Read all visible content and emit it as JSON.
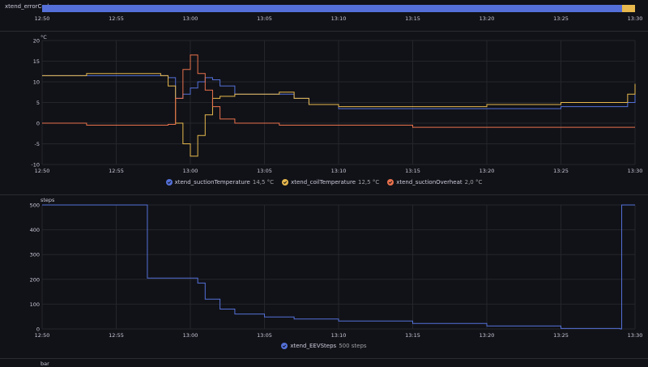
{
  "state_timeline": {
    "label": "xtend_errorCode",
    "x_ticks": [
      "12:50",
      "12:55",
      "13:00",
      "13:05",
      "13:10",
      "13:15",
      "13:20",
      "13:25",
      "13:30"
    ],
    "colors": {
      "main": "#5470d8",
      "end": "#e6b84d"
    }
  },
  "temp_panel": {
    "unit": "°C",
    "y_ticks": [
      "20",
      "15",
      "10",
      "5",
      "0",
      "-5",
      "-10"
    ],
    "x_ticks": [
      "12:50",
      "12:55",
      "13:00",
      "13:05",
      "13:10",
      "13:15",
      "13:20",
      "13:25",
      "13:30"
    ],
    "legend": [
      {
        "name": "xtend_suctionTemperature",
        "value": "14,5 °C",
        "color": "#5470d8"
      },
      {
        "name": "xtend_coilTemperature",
        "value": "12,5 °C",
        "color": "#e6b84d"
      },
      {
        "name": "xtend_suctionOverheat",
        "value": "2,0 °C",
        "color": "#e8714c"
      }
    ]
  },
  "eev_panel": {
    "unit": "steps",
    "y_ticks": [
      "500",
      "400",
      "300",
      "200",
      "100",
      "0"
    ],
    "x_ticks": [
      "12:50",
      "12:55",
      "13:00",
      "13:05",
      "13:10",
      "13:15",
      "13:20",
      "13:25",
      "13:30"
    ],
    "legend": [
      {
        "name": "xtend_EEVSteps",
        "value": "500 steps",
        "color": "#5470d8"
      }
    ]
  },
  "bar_panel": {
    "unit": "bar"
  },
  "chart_data": [
    {
      "type": "line",
      "ylabel": "°C",
      "ylim": [
        -10,
        20
      ],
      "xlim": [
        "12:50",
        "13:30"
      ],
      "grid": true,
      "legend": "bottom",
      "x": [
        "12:50",
        "12:53",
        "12:56",
        "12:58",
        "12:58.5",
        "12:59",
        "12:59.5",
        "13:00",
        "13:00.5",
        "13:01",
        "13:01.5",
        "13:02",
        "13:03",
        "13:05",
        "13:06",
        "13:07",
        "13:08",
        "13:10",
        "13:15",
        "13:20",
        "13:25",
        "13:29",
        "13:29.5",
        "13:30"
      ],
      "series": [
        {
          "name": "xtend_suctionTemperature",
          "color": "#5470d8",
          "values": [
            11.5,
            11.5,
            11.5,
            11.5,
            11,
            6,
            7,
            8.5,
            10,
            11,
            10.5,
            9,
            7,
            7,
            7,
            6,
            4.5,
            3.5,
            3.5,
            3.5,
            4,
            4,
            5,
            8.5
          ]
        },
        {
          "name": "xtend_coilTemperature",
          "color": "#e6b84d",
          "values": [
            11.5,
            12,
            12,
            11.5,
            9,
            0,
            -5,
            -8,
            -3,
            2,
            6,
            6.5,
            7,
            7,
            7.5,
            6,
            4.5,
            4,
            4,
            4.5,
            5,
            5,
            7,
            9.5
          ]
        },
        {
          "name": "xtend_suctionOverheat",
          "color": "#e8714c",
          "values": [
            0,
            -0.5,
            -0.5,
            -0.5,
            -0.3,
            6,
            13,
            16.5,
            12,
            8,
            4,
            1,
            0,
            0,
            -0.5,
            -0.5,
            -0.5,
            -0.5,
            -1,
            -1,
            -1,
            -1,
            -1,
            -1
          ]
        }
      ]
    },
    {
      "type": "line",
      "ylabel": "steps",
      "ylim": [
        0,
        500
      ],
      "xlim": [
        "12:50",
        "13:30"
      ],
      "grid": true,
      "legend": "bottom",
      "x": [
        "12:50",
        "12:57",
        "12:57.1",
        "12:59.8",
        "13:00",
        "13:00.5",
        "13:01",
        "13:02",
        "13:03",
        "13:05",
        "13:07",
        "13:10",
        "13:15",
        "13:20",
        "13:25",
        "13:29",
        "13:29.1",
        "13:30"
      ],
      "series": [
        {
          "name": "xtend_EEVSteps",
          "color": "#5470d8",
          "values": [
            500,
            500,
            205,
            205,
            205,
            185,
            120,
            80,
            60,
            48,
            40,
            32,
            22,
            12,
            2,
            0,
            500,
            500
          ]
        }
      ]
    }
  ]
}
